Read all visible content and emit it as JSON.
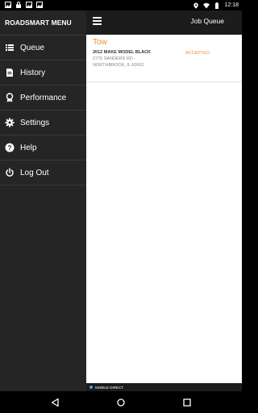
{
  "status_bar": {
    "time": "12:18"
  },
  "drawer": {
    "title": "ROADSMART MENU",
    "items": [
      {
        "label": "Queue",
        "icon": "list-icon"
      },
      {
        "label": "History",
        "icon": "document-icon"
      },
      {
        "label": "Performance",
        "icon": "award-icon"
      },
      {
        "label": "Settings",
        "icon": "gear-icon"
      },
      {
        "label": "Help",
        "icon": "help-icon"
      },
      {
        "label": "Log Out",
        "icon": "power-icon"
      }
    ]
  },
  "toolbar": {
    "title": "Job Queue"
  },
  "jobs": [
    {
      "type": "Tow",
      "vehicle": "2012 MAKE MODEL BLACK",
      "address": "2775 SANDERS RD -",
      "city": "NORTHBROOK, IL 60062",
      "status": "ACCEPTED"
    }
  ],
  "footer": {
    "label": "MOBILE DIRECT"
  },
  "colors": {
    "accent": "#f0902c",
    "drawer_bg": "#252525",
    "toolbar_bg": "#1c1c1c",
    "indicator": "#4aa3df"
  }
}
